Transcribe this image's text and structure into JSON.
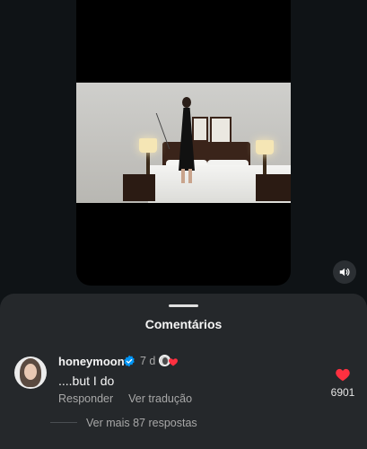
{
  "sheet": {
    "title": "Comentários"
  },
  "comment": {
    "username": "honeymoon",
    "time": "7 d",
    "text": "....but I do",
    "reply_label": "Responder",
    "translate_label": "Ver tradução",
    "like_count": "6901",
    "view_replies_label": "Ver mais 87 respostas"
  },
  "colors": {
    "heart": "#ff3040",
    "verified": "#0095f6",
    "sheet_bg": "#25282b"
  },
  "icons": {
    "sound": "speaker-icon",
    "verified": "verified-badge-icon",
    "like": "heart-icon"
  }
}
